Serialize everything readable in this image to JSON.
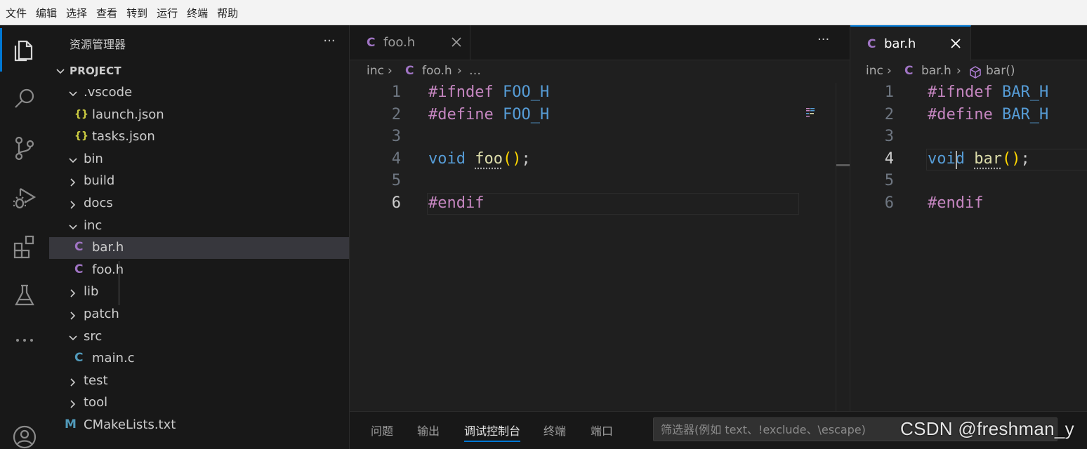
{
  "menubar": {
    "items": [
      "文件",
      "编辑",
      "选择",
      "查看",
      "转到",
      "运行",
      "终端",
      "帮助"
    ]
  },
  "activitybar": {
    "items": [
      "files-icon",
      "search-icon",
      "source-control-icon",
      "run-debug-icon",
      "extensions-icon",
      "testing-icon",
      "more-icon"
    ],
    "bottom": [
      "account-icon"
    ]
  },
  "explorer": {
    "title": "资源管理器",
    "more": "···",
    "section": "PROJECT",
    "items": [
      {
        "label": ".vscode",
        "kind": "folder",
        "open": true
      },
      {
        "label": "launch.json",
        "kind": "json",
        "icon": "{}"
      },
      {
        "label": "tasks.json",
        "kind": "json",
        "icon": "{}"
      },
      {
        "label": "bin",
        "kind": "folder",
        "open": true
      },
      {
        "label": "build",
        "kind": "folder",
        "open": false
      },
      {
        "label": "docs",
        "kind": "folder",
        "open": false
      },
      {
        "label": "inc",
        "kind": "folder",
        "open": true
      },
      {
        "label": "bar.h",
        "kind": "c-header",
        "icon": "C",
        "selected": true
      },
      {
        "label": "foo.h",
        "kind": "c-header",
        "icon": "C"
      },
      {
        "label": "lib",
        "kind": "folder",
        "open": false
      },
      {
        "label": "patch",
        "kind": "folder",
        "open": false
      },
      {
        "label": "src",
        "kind": "folder",
        "open": true
      },
      {
        "label": "main.c",
        "kind": "c-source",
        "icon": "C"
      },
      {
        "label": "test",
        "kind": "folder",
        "open": false
      },
      {
        "label": "tool",
        "kind": "folder",
        "open": false
      },
      {
        "label": "CMakeLists.txt",
        "kind": "cmake",
        "icon": "M"
      }
    ]
  },
  "colors": {
    "accent": "#0078d4",
    "c_header_icon": "#a074c4",
    "c_source_icon": "#519aba",
    "json_icon": "#cbcb41",
    "preprocessor": "#c586c0",
    "macro": "#569cd6",
    "function": "#dcdcaa",
    "bracket": "#ffd700"
  },
  "editor1": {
    "tab": {
      "icon": "C",
      "label": "foo.h"
    },
    "more": "···",
    "breadcrumb": {
      "folder": "inc",
      "sep": "›",
      "file_icon": "C",
      "file": "foo.h",
      "ellipsis": "…"
    },
    "current_line": 6,
    "lines": [
      {
        "num": "1",
        "tokens": [
          {
            "t": "#ifndef",
            "c": "pp"
          },
          {
            "t": " "
          },
          {
            "t": "FOO_H",
            "c": "macro"
          }
        ]
      },
      {
        "num": "2",
        "tokens": [
          {
            "t": "#define",
            "c": "pp"
          },
          {
            "t": " "
          },
          {
            "t": "FOO_H",
            "c": "macro"
          }
        ]
      },
      {
        "num": "3",
        "tokens": []
      },
      {
        "num": "4",
        "tokens": [
          {
            "t": "void",
            "c": "type"
          },
          {
            "t": " "
          },
          {
            "t": "foo",
            "c": "fn-dotted"
          },
          {
            "t": "()",
            "c": "paren"
          },
          {
            "t": ";"
          }
        ]
      },
      {
        "num": "5",
        "tokens": []
      },
      {
        "num": "6",
        "tokens": [
          {
            "t": "#endif",
            "c": "pp"
          }
        ]
      }
    ]
  },
  "editor2": {
    "tab": {
      "icon": "C",
      "label": "bar.h"
    },
    "breadcrumb": {
      "folder": "inc",
      "sep": "›",
      "file_icon": "C",
      "file": "bar.h",
      "symbol_icon": "symbol-method-icon",
      "symbol": "bar()"
    },
    "current_line": 4,
    "lines": [
      {
        "num": "1",
        "tokens": [
          {
            "t": "#ifndef",
            "c": "pp"
          },
          {
            "t": " "
          },
          {
            "t": "BAR_H",
            "c": "macro"
          }
        ]
      },
      {
        "num": "2",
        "tokens": [
          {
            "t": "#define",
            "c": "pp"
          },
          {
            "t": " "
          },
          {
            "t": "BAR_H",
            "c": "macro"
          }
        ]
      },
      {
        "num": "3",
        "tokens": []
      },
      {
        "num": "4",
        "tokens": [
          {
            "t": "void",
            "c": "type"
          },
          {
            "t": " "
          },
          {
            "t": "bar",
            "c": "fn-dotted"
          },
          {
            "t": "()",
            "c": "paren"
          },
          {
            "t": ";"
          }
        ]
      },
      {
        "num": "5",
        "tokens": []
      },
      {
        "num": "6",
        "tokens": [
          {
            "t": "#endif",
            "c": "pp"
          }
        ]
      }
    ]
  },
  "panel": {
    "tabs": [
      {
        "label": "问题"
      },
      {
        "label": "输出"
      },
      {
        "label": "调试控制台",
        "active": true
      },
      {
        "label": "终端"
      },
      {
        "label": "端口"
      }
    ],
    "filter_placeholder": "筛选器(例如 text、!exclude、\\escape)"
  },
  "watermark": "CSDN @freshman_y"
}
